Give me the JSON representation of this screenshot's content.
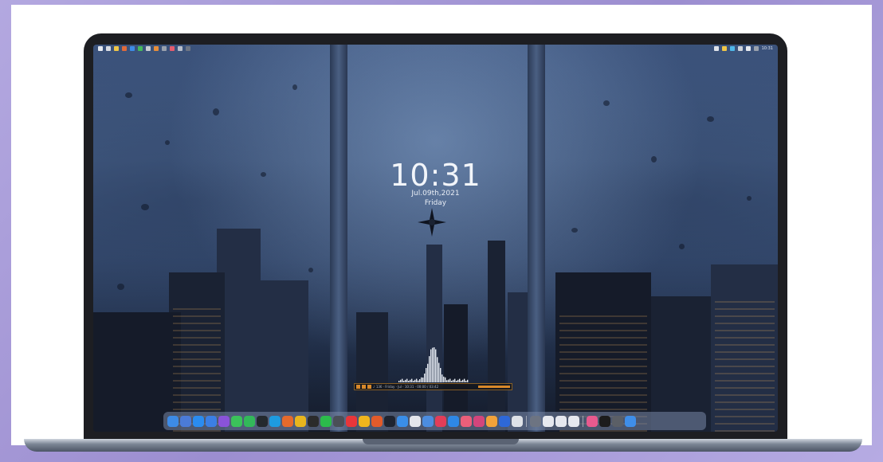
{
  "clock": {
    "time": "10:31",
    "date": "Jul.09th,2021",
    "day": "Friday"
  },
  "menubar": {
    "left_icons": [
      "apple-icon",
      "finder-icon",
      "folder-icon",
      "mail-icon",
      "calendar-icon",
      "safari-icon",
      "settings-icon",
      "user-icon",
      "notes-icon",
      "photos-icon",
      "music-icon",
      "lock-icon"
    ],
    "right_icons": [
      "battery-icon",
      "wifi-icon",
      "bluetooth-icon",
      "volume-icon",
      "search-icon",
      "control-center-icon"
    ]
  },
  "dock": {
    "icons": [
      {
        "name": "finder-icon",
        "color": "#3d8be6"
      },
      {
        "name": "launchpad-icon",
        "color": "#4b7bd8"
      },
      {
        "name": "app-store-icon",
        "color": "#2a8cf0"
      },
      {
        "name": "mail-icon",
        "color": "#3b7fe4"
      },
      {
        "name": "iris-icon",
        "color": "#8a53d8"
      },
      {
        "name": "facetime-icon",
        "color": "#3bc25a"
      },
      {
        "name": "messages-icon",
        "color": "#33b85a"
      },
      {
        "name": "github-icon",
        "color": "#24292e"
      },
      {
        "name": "edge-icon",
        "color": "#1e9be0"
      },
      {
        "name": "firefox-icon",
        "color": "#e56a2c"
      },
      {
        "name": "chrome-icon",
        "color": "#e8b51e"
      },
      {
        "name": "qq-icon",
        "color": "#2b2b2b"
      },
      {
        "name": "wechat-icon",
        "color": "#2cbb4b"
      },
      {
        "name": "screenshot-icon",
        "color": "#4a4f57"
      },
      {
        "name": "weibo-icon",
        "color": "#e8363a"
      },
      {
        "name": "chrome-canary-icon",
        "color": "#f0b51d"
      },
      {
        "name": "tools-icon",
        "color": "#e25b2b"
      },
      {
        "name": "terminal-icon",
        "color": "#1f2430"
      },
      {
        "name": "finder-2-icon",
        "color": "#3a8ee8"
      },
      {
        "name": "calendar-icon",
        "color": "#e4e6ec"
      },
      {
        "name": "notes-icon",
        "color": "#4c8de0"
      },
      {
        "name": "music-icon",
        "color": "#e23d58"
      },
      {
        "name": "search-icon",
        "color": "#2e88e6"
      },
      {
        "name": "photos-icon",
        "color": "#ea5f7a"
      },
      {
        "name": "vector-icon",
        "color": "#d2457c"
      },
      {
        "name": "compass-icon",
        "color": "#f2a23a"
      },
      {
        "name": "video-icon",
        "color": "#2e68d8"
      },
      {
        "name": "qr-icon",
        "color": "#dfe2e8"
      },
      {
        "name": "power-icon",
        "color": "#6d7482"
      },
      {
        "name": "window-1-icon",
        "color": "#e6e8ee"
      },
      {
        "name": "window-2-icon",
        "color": "#e6e8ee"
      },
      {
        "name": "window-3-icon",
        "color": "#e6e8ee"
      },
      {
        "name": "color-wheel-icon",
        "color": "#e85a8e"
      },
      {
        "name": "fireworks-icon",
        "color": "#1c1c1c"
      },
      {
        "name": "settings-icon",
        "color": "#5b5f66"
      },
      {
        "name": "trash-icon",
        "color": "#3f8ee8"
      }
    ]
  },
  "player": {
    "track": "♪ 136 · Friday · Jul · 10:31 · 00:00 / 03:42",
    "controls": [
      "prev-icon",
      "play-icon",
      "next-icon"
    ]
  }
}
